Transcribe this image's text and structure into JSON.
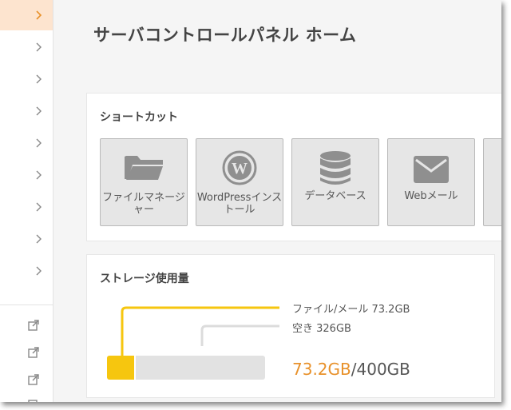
{
  "page": {
    "title": "サーバコントロールパネル ホーム"
  },
  "shortcut": {
    "heading": "ショートカット",
    "tiles": [
      {
        "label": "ファイルマネージャー",
        "icon": "folder-icon"
      },
      {
        "label": "WordPressインストール",
        "icon": "wordpress-icon"
      },
      {
        "label": "データベース",
        "icon": "database-icon"
      },
      {
        "label": "Webメール",
        "icon": "mail-icon"
      }
    ]
  },
  "storage": {
    "heading": "ストレージ使用量",
    "legend_used": "ファイル/メール 73.2GB",
    "legend_free": "空き 326GB",
    "used": "73.2GB",
    "total": "/400GB",
    "used_fraction": 0.183,
    "colors": {
      "used": "#f6c60f",
      "free": "#e2e2e2",
      "used_text": "#e8912a"
    }
  },
  "sidebar": {
    "nav_icons": [
      "chevron-right-icon"
    ],
    "link_icons": [
      "external-link-icon"
    ]
  }
}
